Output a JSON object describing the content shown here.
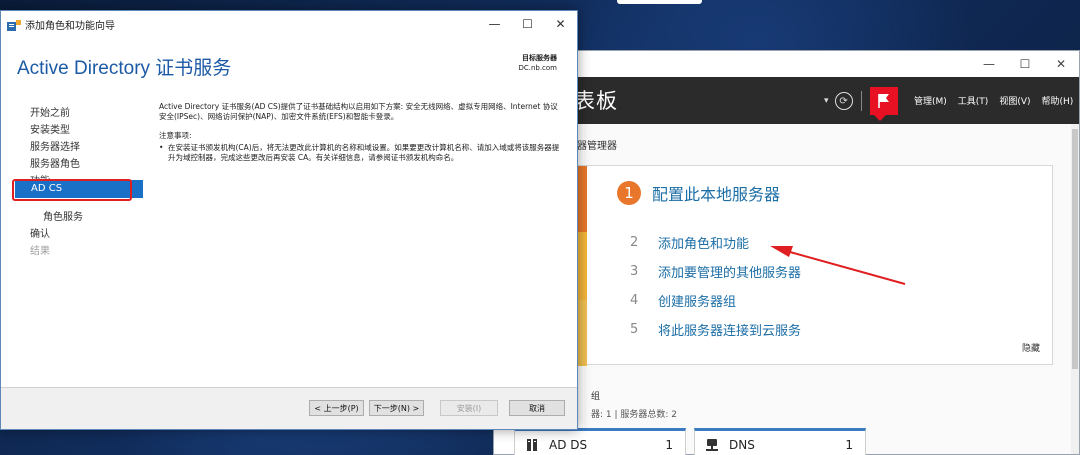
{
  "server_manager": {
    "window_controls": [
      "—",
      "☐",
      "✕"
    ],
    "title_partial": "表板",
    "menu": [
      "管理(M)",
      "工具(T)",
      "视图(V)",
      "帮助(H)"
    ],
    "breadcrumb_partial": "器管理器",
    "quick_start": {
      "step_num": "1",
      "title": "配置此本地服务器",
      "items": [
        {
          "num": "2",
          "label": "添加角色和功能"
        },
        {
          "num": "3",
          "label": "添加要管理的其他服务器"
        },
        {
          "num": "4",
          "label": "创建服务器组"
        },
        {
          "num": "5",
          "label": "将此服务器连接到云服务"
        }
      ],
      "hide_label": "隐藏"
    },
    "roles_title_partial": "组",
    "roles_subtitle": "器: 1 | 服务器总数: 2",
    "tiles": [
      {
        "label": "AD DS",
        "count": "1",
        "icon": "ad-ds-icon"
      },
      {
        "label": "DNS",
        "count": "1",
        "icon": "dns-icon"
      }
    ]
  },
  "wizard": {
    "window_title": "添加角色和功能向导",
    "window_controls": [
      "—",
      "☐",
      "✕"
    ],
    "heading": "Active Directory 证书服务",
    "target_label": "目标服务器",
    "target_server": "DC.nb.com",
    "nav": [
      {
        "label": "开始之前",
        "state": "normal"
      },
      {
        "label": "安装类型",
        "state": "normal"
      },
      {
        "label": "服务器选择",
        "state": "normal"
      },
      {
        "label": "服务器角色",
        "state": "normal"
      },
      {
        "label": "功能",
        "state": "normal"
      },
      {
        "label": "AD CS",
        "state": "active"
      },
      {
        "label": "角色服务",
        "state": "sub"
      },
      {
        "label": "确认",
        "state": "normal"
      },
      {
        "label": "结果",
        "state": "dim"
      }
    ],
    "description": "Active Directory 证书服务(AD CS)提供了证书基础结构以启用如下方案: 安全无线网络、虚拟专用网络、Internet 协议安全(IPSec)、网络访问保护(NAP)、加密文件系统(EFS)和智能卡登录。",
    "note_title": "注意事项:",
    "note_bullet": "•",
    "note_text": "在安装证书颁发机构(CA)后，将无法更改此计算机的名称和域设置。如果要更改计算机名称、请加入域或将该服务器提升为域控制器，完成这些更改后再安装 CA。有关详细信息，请参阅证书颁发机构命名。",
    "buttons": {
      "prev": "< 上一步(P)",
      "next": "下一步(N) >",
      "install": "安装(I)",
      "cancel": "取消"
    }
  },
  "colors": {
    "accent_blue": "#1a6fc6",
    "heading_blue": "#1c5aa6",
    "link_blue": "#1c6ea6",
    "orange": "#e9772b",
    "annotation_red": "#e02020",
    "flag_red": "#e81123"
  }
}
